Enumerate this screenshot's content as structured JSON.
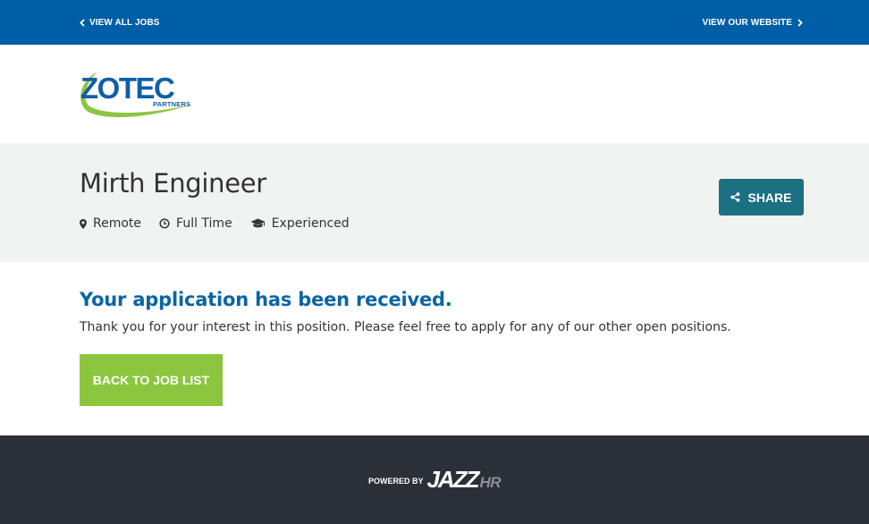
{
  "topbar": {
    "left_link": "VIEW ALL JOBS",
    "right_link": "VIEW OUR WEBSITE"
  },
  "logo": {
    "name": "ZOTEC",
    "subtitle": "PARTNERS",
    "colors": {
      "blue": "#0f5fa8",
      "green": "#8cc63f"
    }
  },
  "job": {
    "title": "Mirth Engineer",
    "location": "Remote",
    "type": "Full Time",
    "experience": "Experienced",
    "share_label": "SHARE"
  },
  "confirmation": {
    "heading": "Your application has been received.",
    "message": "Thank you for your interest in this position. Please feel free to apply for any of our other open positions.",
    "back_button": "BACK TO JOB LIST"
  },
  "footer": {
    "powered_by": "POWERED BY",
    "brand_jazz": "JAZZ",
    "brand_hr": "HR"
  },
  "colors": {
    "topbar": "#005ea7",
    "header_bg": "#f1f2f2",
    "share_button": "#1b7082",
    "heading": "#0a65a5",
    "back_button": "#8cc63f",
    "footer": "#2b3038"
  },
  "icons": {
    "left_link": "chevron-left-icon",
    "right_link": "chevron-right-icon",
    "location": "map-pin-icon",
    "type": "clock-icon",
    "experience": "graduation-cap-icon",
    "share": "share-icon"
  }
}
